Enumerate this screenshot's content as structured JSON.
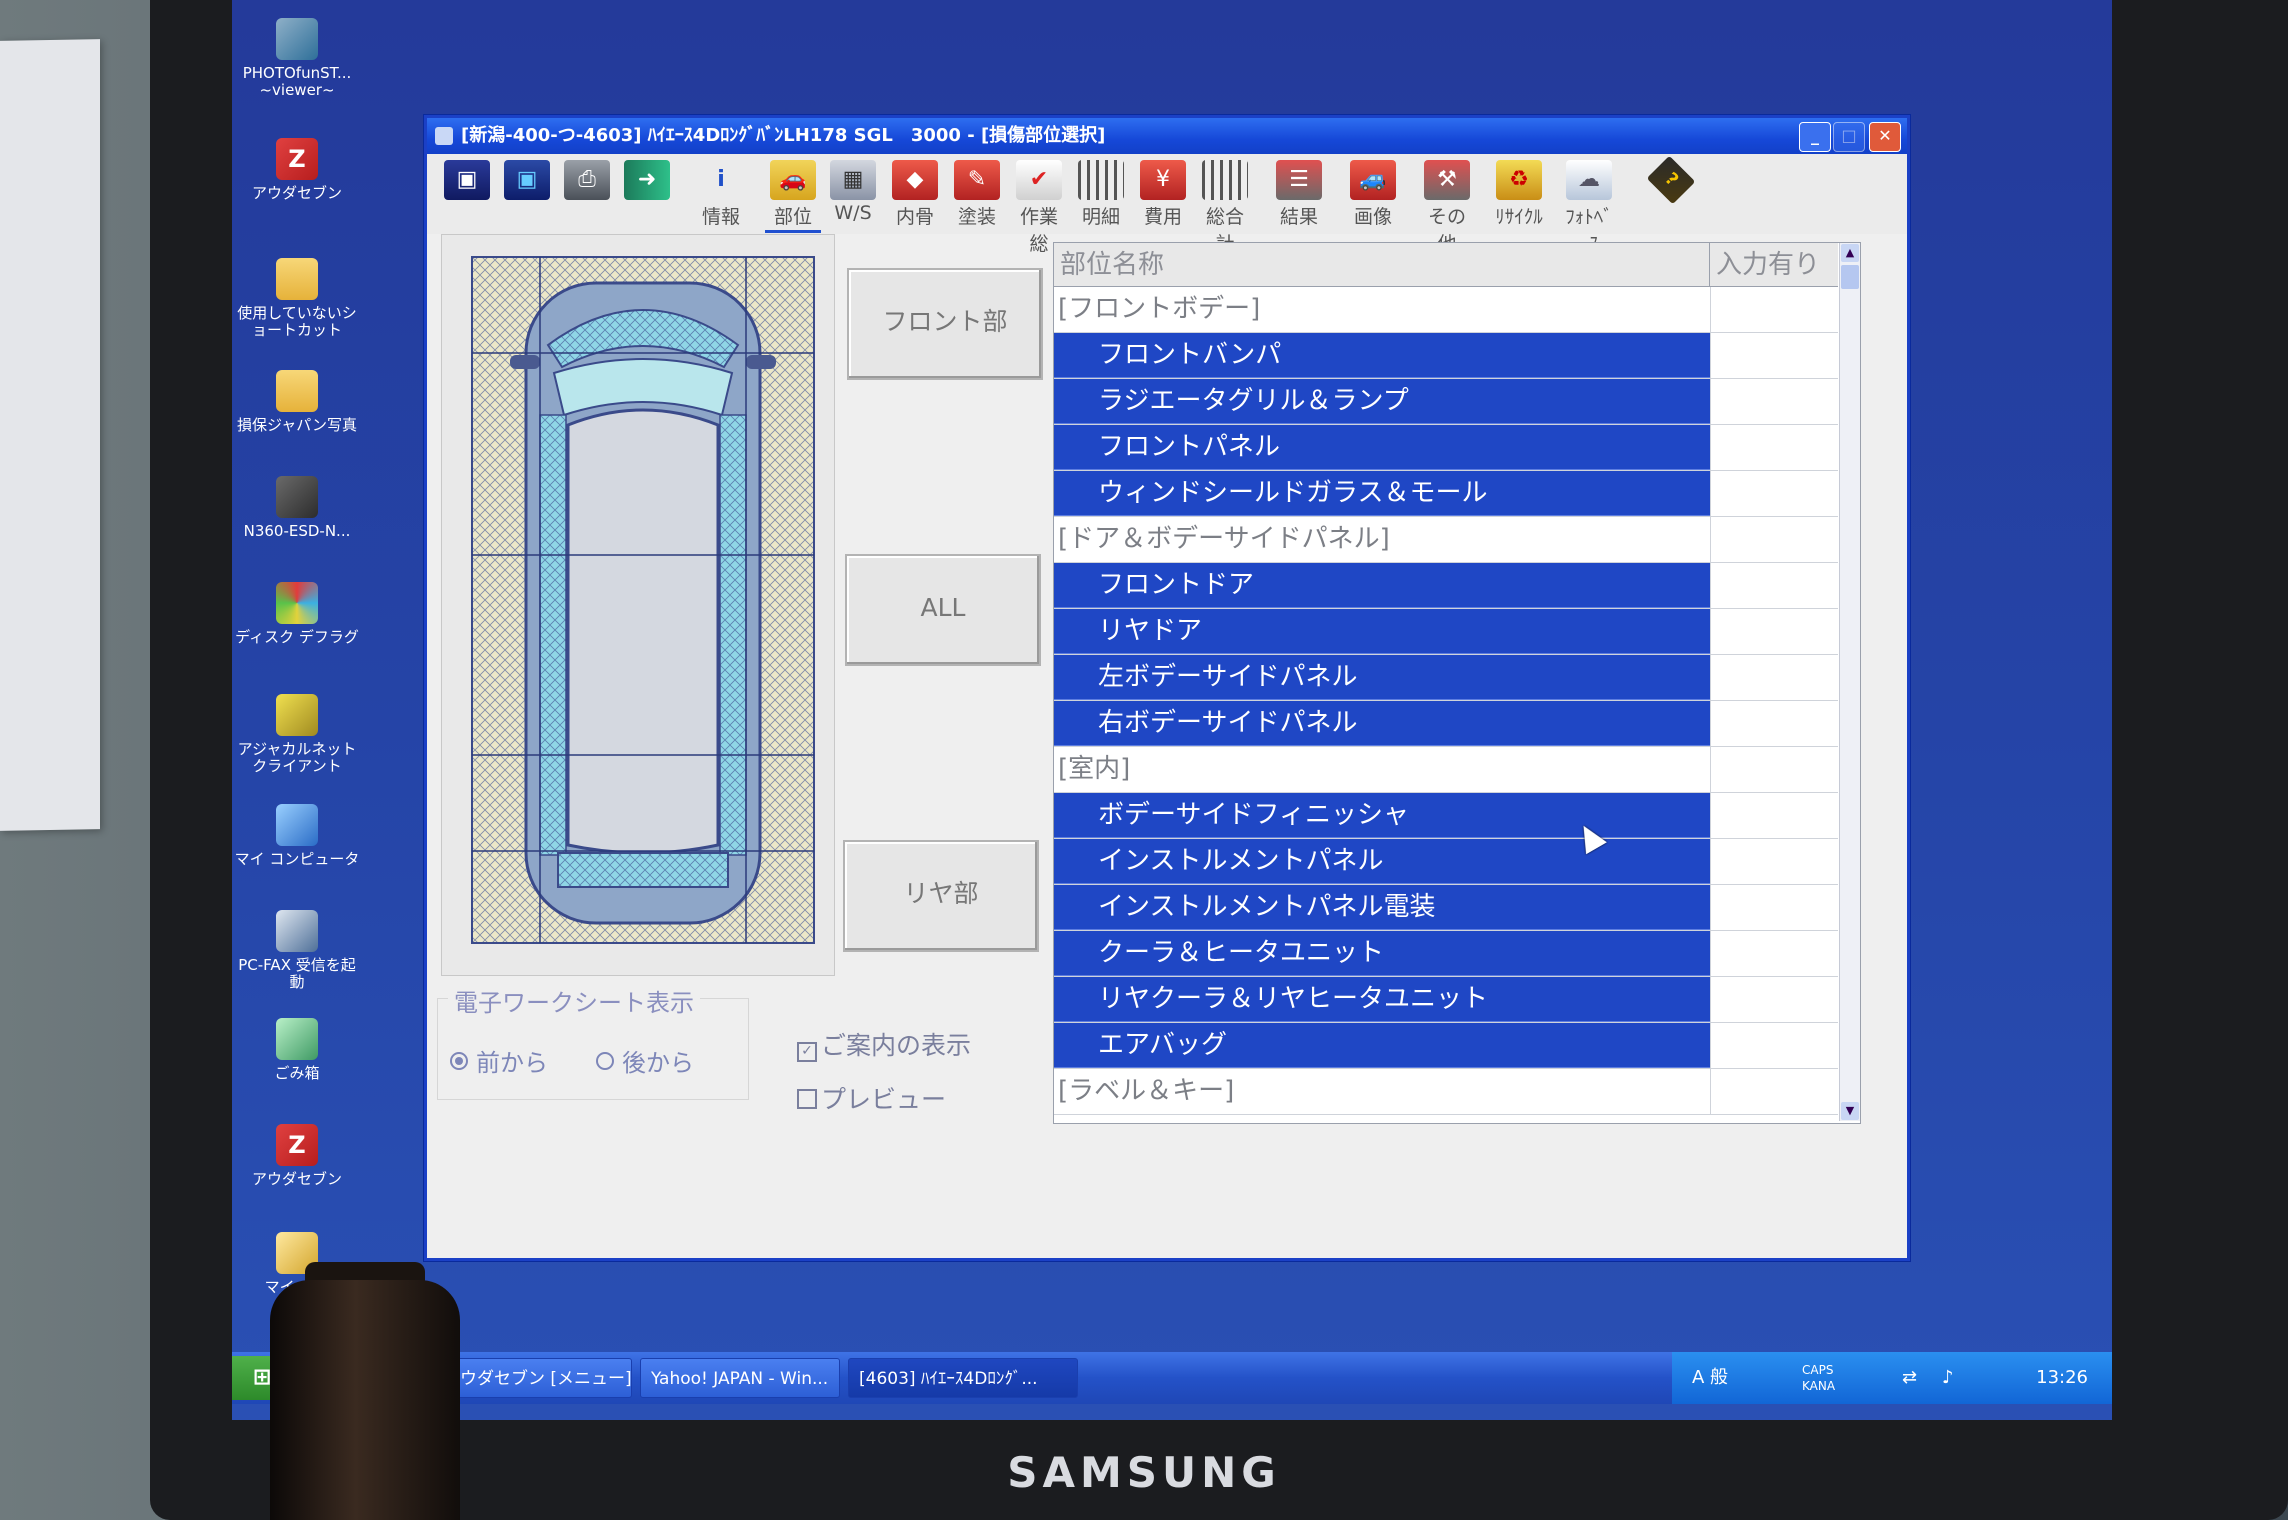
{
  "monitor": {
    "brand": "SAMSUNG"
  },
  "desktop": {
    "icons": [
      {
        "label": "PHOTOfunST... ~viewer~",
        "icon": "photo-viewer-icon"
      },
      {
        "label": "アウダセブン",
        "icon": "audatex-icon"
      },
      {
        "label": "使用していないショートカット",
        "icon": "folder-icon"
      },
      {
        "label": "損保ジャパン写真",
        "icon": "folder-icon"
      },
      {
        "label": "N360-ESD-N...",
        "icon": "n360-icon"
      },
      {
        "label": "ディスク デフラグ",
        "icon": "defrag-icon"
      },
      {
        "label": "アジャカルネット クライアント",
        "icon": "network-client-icon"
      },
      {
        "label": "マイ コンピュータ",
        "icon": "my-computer-icon"
      },
      {
        "label": "PC-FAX 受信を起動",
        "icon": "fax-icon"
      },
      {
        "label": "ごみ箱",
        "icon": "recycle-bin-icon"
      },
      {
        "label": "アウダセブン",
        "icon": "audatex-icon"
      },
      {
        "label": "マイ ドキ",
        "icon": "my-documents-icon"
      }
    ]
  },
  "window": {
    "title": "[新潟-400-つ-4603] ﾊｲｴｰｽ4DﾛﾝｸﾞﾊﾞﾝLH178 SGL　3000 - [損傷部位選択]",
    "controls": {
      "minimize": "_",
      "maximize": "□",
      "close": "✕"
    }
  },
  "toolbar": [
    {
      "label": "",
      "icon": "floppy-save-icon"
    },
    {
      "label": "",
      "icon": "save-as-icon"
    },
    {
      "label": "",
      "icon": "printer-icon"
    },
    {
      "label": "",
      "icon": "exit-door-icon"
    },
    {
      "label": "情報",
      "icon": "info-icon"
    },
    {
      "label": "部位",
      "icon": "car-parts-icon",
      "active": true
    },
    {
      "label": "W/S",
      "icon": "worksheet-icon"
    },
    {
      "label": "内骨",
      "icon": "inner-frame-icon"
    },
    {
      "label": "塗装",
      "icon": "paint-icon"
    },
    {
      "label": "作業総",
      "icon": "checklist-icon"
    },
    {
      "label": "明細",
      "icon": "details-icon"
    },
    {
      "label": "費用",
      "icon": "cost-icon"
    },
    {
      "label": "総合計",
      "icon": "total-icon"
    },
    {
      "label": "結果",
      "icon": "result-icon"
    },
    {
      "label": "画像",
      "icon": "image-icon"
    },
    {
      "label": "その他",
      "icon": "tools-icon"
    },
    {
      "label": "ﾘｻｲｸﾙ",
      "icon": "recycle-icon"
    },
    {
      "label": "ﾌｫﾄﾍﾞｰｽ",
      "icon": "photobase-icon"
    },
    {
      "label": "",
      "icon": "help-icon"
    }
  ],
  "sections": {
    "front": "フロント部",
    "all": "ALL",
    "rear": "リヤ部"
  },
  "worksheet": {
    "legend": "電子ワークシート表示",
    "options": [
      {
        "label": "前から",
        "selected": true
      },
      {
        "label": "後から",
        "selected": false
      }
    ],
    "guide": {
      "label": "ご案内の表示",
      "checked": true
    },
    "preview": {
      "label": "プレビュー",
      "checked": false
    }
  },
  "parts_list": {
    "columns": {
      "name": "部位名称",
      "entered": "入力有り"
    },
    "rows": [
      {
        "type": "cat",
        "name": "[フロントボデー]",
        "entered": ""
      },
      {
        "type": "item",
        "name": "フロントバンパ",
        "entered": ""
      },
      {
        "type": "item",
        "name": "ラジエータグリル＆ランプ",
        "entered": ""
      },
      {
        "type": "item",
        "name": "フロントパネル",
        "entered": ""
      },
      {
        "type": "item",
        "name": "ウィンドシールドガラス＆モール",
        "entered": ""
      },
      {
        "type": "cat",
        "name": "[ドア＆ボデーサイドパネル]",
        "entered": ""
      },
      {
        "type": "item",
        "name": "フロントドア",
        "entered": ""
      },
      {
        "type": "item",
        "name": "リヤドア",
        "entered": ""
      },
      {
        "type": "item",
        "name": "左ボデーサイドパネル",
        "entered": ""
      },
      {
        "type": "item",
        "name": "右ボデーサイドパネル",
        "entered": ""
      },
      {
        "type": "cat",
        "name": "[室内]",
        "entered": ""
      },
      {
        "type": "item",
        "name": "ボデーサイドフィニッシャ",
        "entered": ""
      },
      {
        "type": "item",
        "name": "インストルメントパネル",
        "entered": ""
      },
      {
        "type": "item",
        "name": "インストルメントパネル電装",
        "entered": ""
      },
      {
        "type": "item",
        "name": "クーラ＆ヒータユニット",
        "entered": ""
      },
      {
        "type": "item",
        "name": "リヤクーラ＆リヤヒータユニット",
        "entered": ""
      },
      {
        "type": "item",
        "name": "エアバッグ",
        "entered": ""
      },
      {
        "type": "cat",
        "name": "[ラベル＆キー]",
        "entered": ""
      }
    ]
  },
  "taskbar": {
    "start": "",
    "tasks": [
      {
        "label": "アウダセブン [メニュー]",
        "active": false
      },
      {
        "label": "Yahoo! JAPAN - Win...",
        "active": false
      },
      {
        "label": "[4603] ﾊｲｴｰｽ4Dﾛﾝｸﾞ...",
        "active": true
      }
    ],
    "ime": "A 般",
    "caps": "CAPS",
    "kana": "KANA",
    "clock": "13:26"
  },
  "colors": {
    "window_border": "#1b40c6",
    "selected_row": "#1f47c5",
    "desktop": "#2545a8",
    "taskbar": "#2452c8"
  }
}
